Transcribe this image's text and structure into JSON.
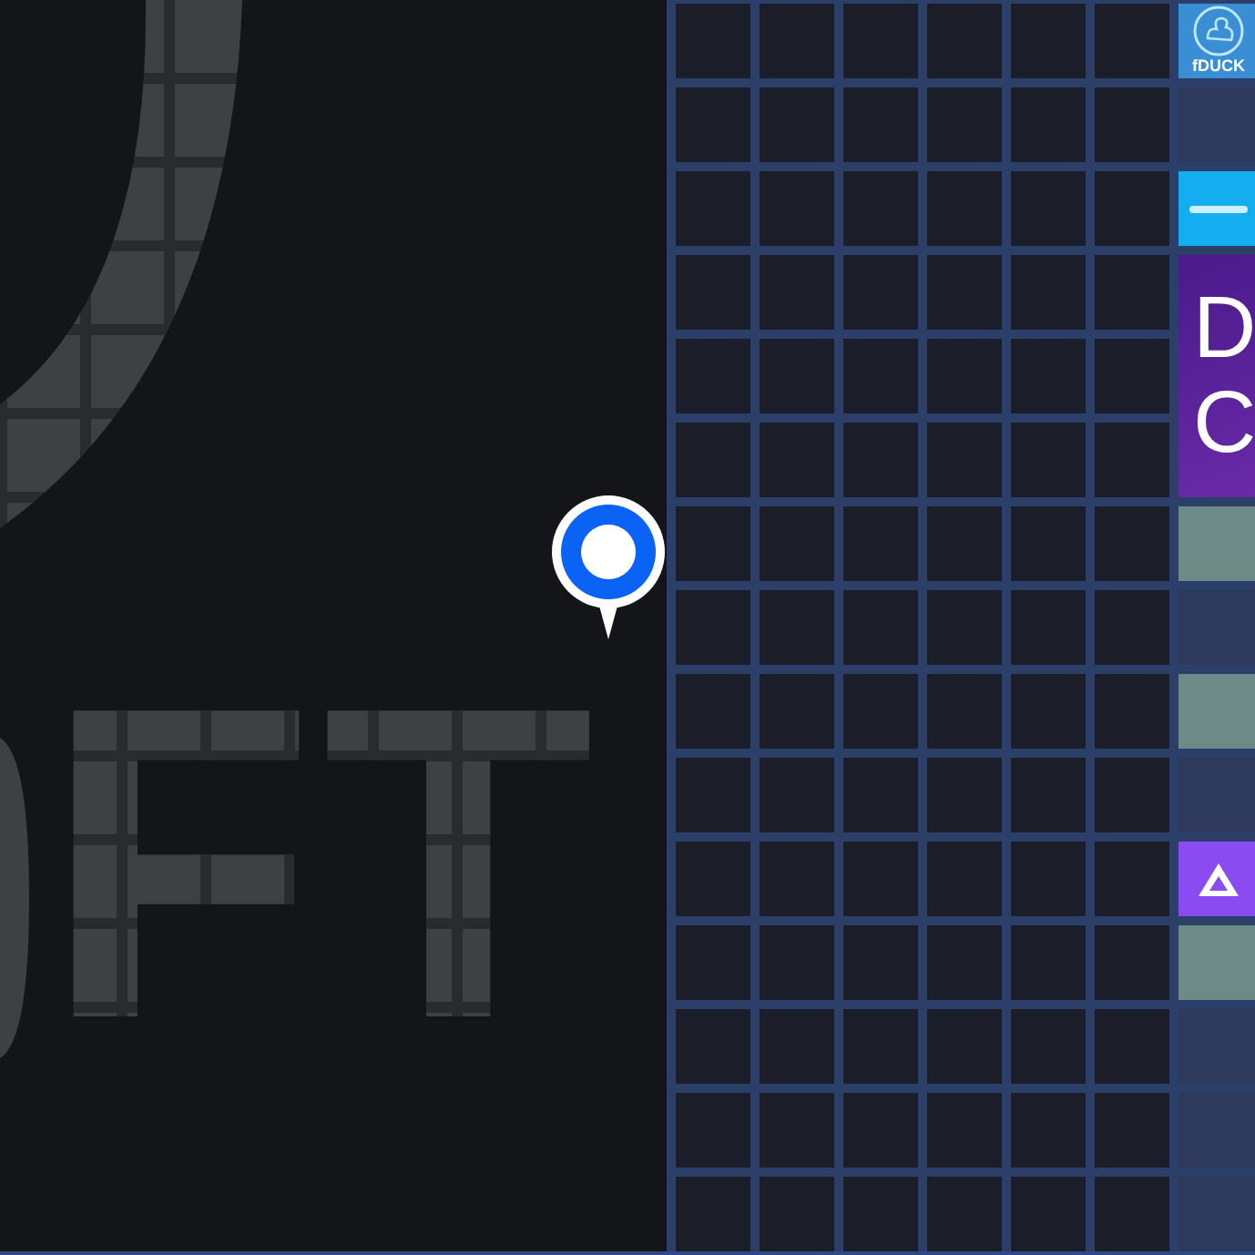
{
  "map": {
    "lettering": "FT",
    "tiles": [
      {
        "kind": "logo",
        "text": "fDUCK"
      },
      {
        "kind": "empty"
      },
      {
        "kind": "banner-small"
      },
      {
        "kind": "banner",
        "lines": [
          "D",
          "C"
        ]
      },
      {
        "kind": "image"
      },
      {
        "kind": "empty"
      },
      {
        "kind": "image"
      },
      {
        "kind": "empty"
      },
      {
        "kind": "triangle-logo"
      },
      {
        "kind": "image"
      },
      {
        "kind": "empty"
      },
      {
        "kind": "empty"
      },
      {
        "kind": "empty"
      }
    ]
  }
}
